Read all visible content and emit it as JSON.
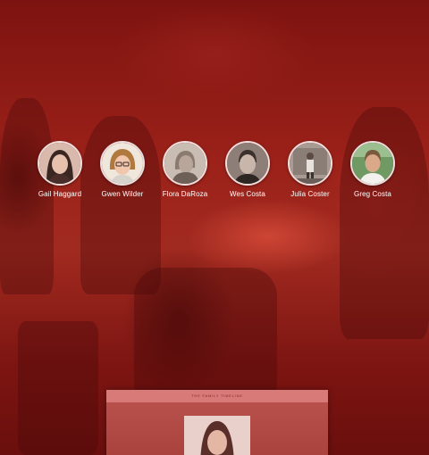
{
  "people": [
    {
      "name": "Gail Haggard",
      "avatar": "portrait-gail-haggard"
    },
    {
      "name": "Gwen Wilder",
      "avatar": "portrait-gwen-wilder"
    },
    {
      "name": "Flora DaRoza",
      "avatar": "portrait-flora-daroza"
    },
    {
      "name": "Wes Costa",
      "avatar": "portrait-wes-costa"
    },
    {
      "name": "Julia Coster",
      "avatar": "portrait-julia-coster"
    },
    {
      "name": "Greg Costa",
      "avatar": "portrait-greg-costa"
    }
  ],
  "preview": {
    "header": "the family timeline"
  },
  "colors": {
    "overlay_red": "#8e1a16",
    "name_text": "#ffffff"
  }
}
